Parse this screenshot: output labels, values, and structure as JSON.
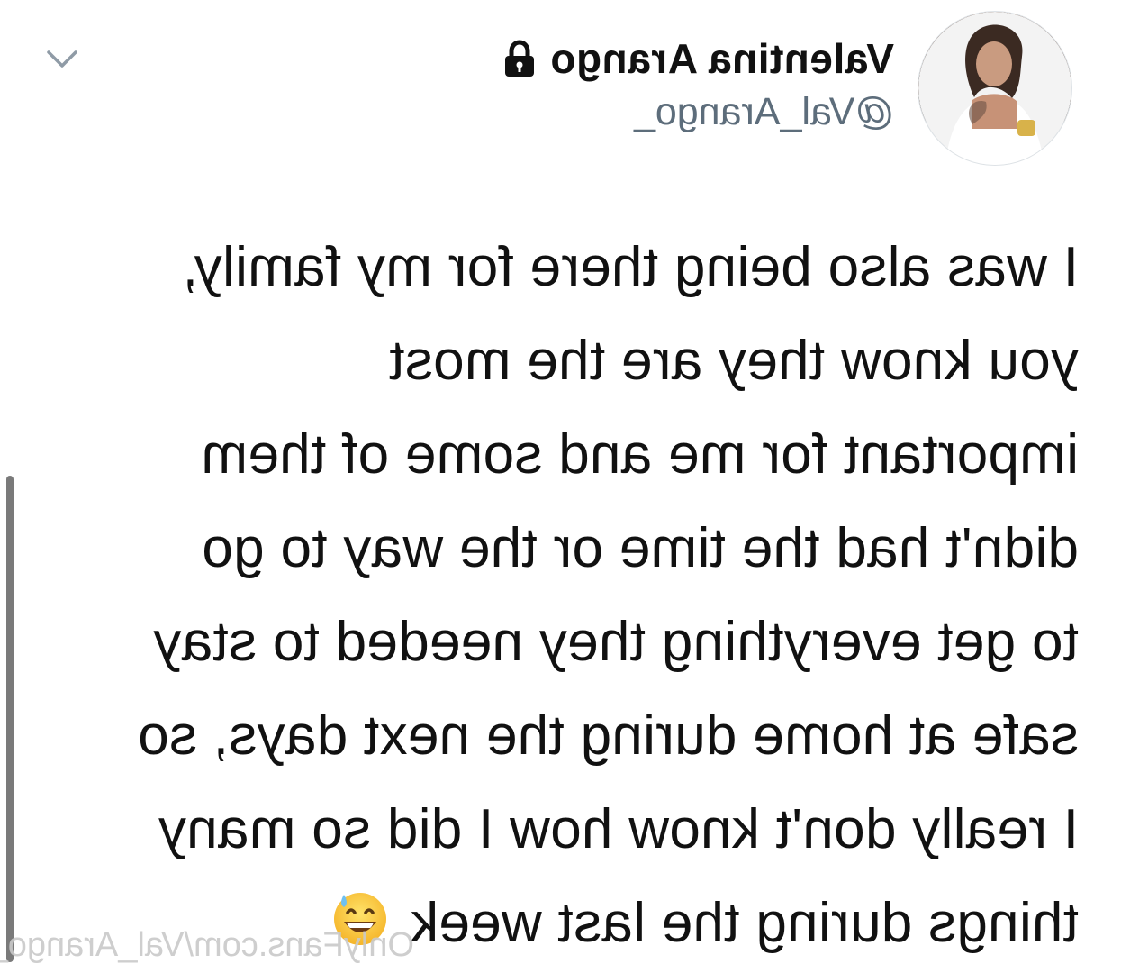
{
  "header": {
    "display_name": "Valentina Arango",
    "handle": "@Val_Arango_"
  },
  "tweet": {
    "lines": [
      "I was also being there for my family,",
      "you know they are the most",
      "important for me and some of them",
      "didn't had the time or the way to go",
      "to get everything they needed to stay",
      "safe at home during the next days, so",
      "I really don't know how I did so many",
      "things during the last week"
    ],
    "emoji": "grinning-face-with-sweat"
  },
  "watermark": "OnlyFans.com/Val_Arango_",
  "icons": {
    "chevron": "chevron-down-icon",
    "lock": "lock-icon"
  },
  "colors": {
    "text": "#111111",
    "handle": "#5d6d7b",
    "chevron": "#8f9ba6",
    "watermark": "#c9c9c9"
  }
}
